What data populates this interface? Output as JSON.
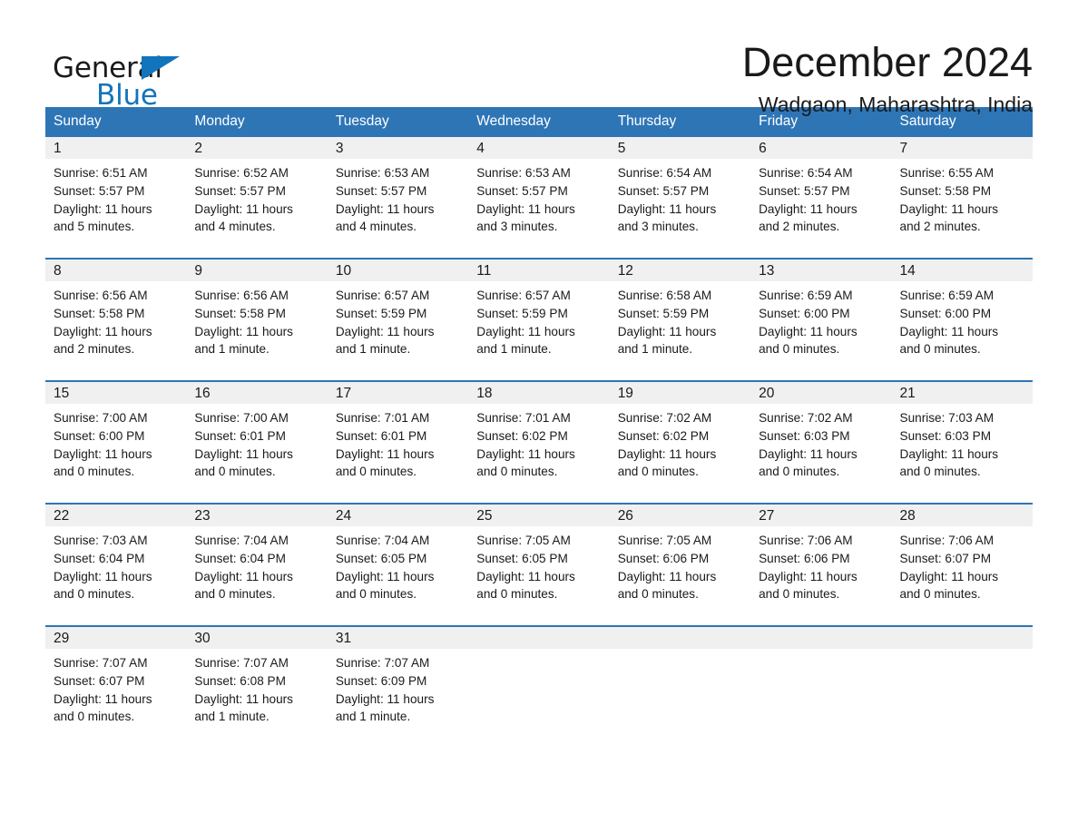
{
  "brand": {
    "word_general": "General",
    "word_blue": "Blue",
    "triangle_color": "#1274bc",
    "logo_icon": "general-blue-logo-icon"
  },
  "header": {
    "title": "December 2024",
    "location": "Wadgaon, Maharashtra, India"
  },
  "theme": {
    "header_bg": "#2e75b6",
    "header_text": "#ffffff",
    "daynum_band_bg": "#f0f0f0",
    "row_divider": "#2e75b6",
    "body_text": "#1a1a1a",
    "page_bg": "#ffffff"
  },
  "weekday_headers": [
    "Sunday",
    "Monday",
    "Tuesday",
    "Wednesday",
    "Thursday",
    "Friday",
    "Saturday"
  ],
  "labels": {
    "sunrise_prefix": "Sunrise:",
    "sunset_prefix": "Sunset:",
    "daylight_prefix": "Daylight:"
  },
  "weeks": [
    [
      {
        "day": "1",
        "sunrise": "Sunrise: 6:51 AM",
        "sunset": "Sunset: 5:57 PM",
        "daylight_line1": "Daylight: 11 hours",
        "daylight_line2": "and 5 minutes."
      },
      {
        "day": "2",
        "sunrise": "Sunrise: 6:52 AM",
        "sunset": "Sunset: 5:57 PM",
        "daylight_line1": "Daylight: 11 hours",
        "daylight_line2": "and 4 minutes."
      },
      {
        "day": "3",
        "sunrise": "Sunrise: 6:53 AM",
        "sunset": "Sunset: 5:57 PM",
        "daylight_line1": "Daylight: 11 hours",
        "daylight_line2": "and 4 minutes."
      },
      {
        "day": "4",
        "sunrise": "Sunrise: 6:53 AM",
        "sunset": "Sunset: 5:57 PM",
        "daylight_line1": "Daylight: 11 hours",
        "daylight_line2": "and 3 minutes."
      },
      {
        "day": "5",
        "sunrise": "Sunrise: 6:54 AM",
        "sunset": "Sunset: 5:57 PM",
        "daylight_line1": "Daylight: 11 hours",
        "daylight_line2": "and 3 minutes."
      },
      {
        "day": "6",
        "sunrise": "Sunrise: 6:54 AM",
        "sunset": "Sunset: 5:57 PM",
        "daylight_line1": "Daylight: 11 hours",
        "daylight_line2": "and 2 minutes."
      },
      {
        "day": "7",
        "sunrise": "Sunrise: 6:55 AM",
        "sunset": "Sunset: 5:58 PM",
        "daylight_line1": "Daylight: 11 hours",
        "daylight_line2": "and 2 minutes."
      }
    ],
    [
      {
        "day": "8",
        "sunrise": "Sunrise: 6:56 AM",
        "sunset": "Sunset: 5:58 PM",
        "daylight_line1": "Daylight: 11 hours",
        "daylight_line2": "and 2 minutes."
      },
      {
        "day": "9",
        "sunrise": "Sunrise: 6:56 AM",
        "sunset": "Sunset: 5:58 PM",
        "daylight_line1": "Daylight: 11 hours",
        "daylight_line2": "and 1 minute."
      },
      {
        "day": "10",
        "sunrise": "Sunrise: 6:57 AM",
        "sunset": "Sunset: 5:59 PM",
        "daylight_line1": "Daylight: 11 hours",
        "daylight_line2": "and 1 minute."
      },
      {
        "day": "11",
        "sunrise": "Sunrise: 6:57 AM",
        "sunset": "Sunset: 5:59 PM",
        "daylight_line1": "Daylight: 11 hours",
        "daylight_line2": "and 1 minute."
      },
      {
        "day": "12",
        "sunrise": "Sunrise: 6:58 AM",
        "sunset": "Sunset: 5:59 PM",
        "daylight_line1": "Daylight: 11 hours",
        "daylight_line2": "and 1 minute."
      },
      {
        "day": "13",
        "sunrise": "Sunrise: 6:59 AM",
        "sunset": "Sunset: 6:00 PM",
        "daylight_line1": "Daylight: 11 hours",
        "daylight_line2": "and 0 minutes."
      },
      {
        "day": "14",
        "sunrise": "Sunrise: 6:59 AM",
        "sunset": "Sunset: 6:00 PM",
        "daylight_line1": "Daylight: 11 hours",
        "daylight_line2": "and 0 minutes."
      }
    ],
    [
      {
        "day": "15",
        "sunrise": "Sunrise: 7:00 AM",
        "sunset": "Sunset: 6:00 PM",
        "daylight_line1": "Daylight: 11 hours",
        "daylight_line2": "and 0 minutes."
      },
      {
        "day": "16",
        "sunrise": "Sunrise: 7:00 AM",
        "sunset": "Sunset: 6:01 PM",
        "daylight_line1": "Daylight: 11 hours",
        "daylight_line2": "and 0 minutes."
      },
      {
        "day": "17",
        "sunrise": "Sunrise: 7:01 AM",
        "sunset": "Sunset: 6:01 PM",
        "daylight_line1": "Daylight: 11 hours",
        "daylight_line2": "and 0 minutes."
      },
      {
        "day": "18",
        "sunrise": "Sunrise: 7:01 AM",
        "sunset": "Sunset: 6:02 PM",
        "daylight_line1": "Daylight: 11 hours",
        "daylight_line2": "and 0 minutes."
      },
      {
        "day": "19",
        "sunrise": "Sunrise: 7:02 AM",
        "sunset": "Sunset: 6:02 PM",
        "daylight_line1": "Daylight: 11 hours",
        "daylight_line2": "and 0 minutes."
      },
      {
        "day": "20",
        "sunrise": "Sunrise: 7:02 AM",
        "sunset": "Sunset: 6:03 PM",
        "daylight_line1": "Daylight: 11 hours",
        "daylight_line2": "and 0 minutes."
      },
      {
        "day": "21",
        "sunrise": "Sunrise: 7:03 AM",
        "sunset": "Sunset: 6:03 PM",
        "daylight_line1": "Daylight: 11 hours",
        "daylight_line2": "and 0 minutes."
      }
    ],
    [
      {
        "day": "22",
        "sunrise": "Sunrise: 7:03 AM",
        "sunset": "Sunset: 6:04 PM",
        "daylight_line1": "Daylight: 11 hours",
        "daylight_line2": "and 0 minutes."
      },
      {
        "day": "23",
        "sunrise": "Sunrise: 7:04 AM",
        "sunset": "Sunset: 6:04 PM",
        "daylight_line1": "Daylight: 11 hours",
        "daylight_line2": "and 0 minutes."
      },
      {
        "day": "24",
        "sunrise": "Sunrise: 7:04 AM",
        "sunset": "Sunset: 6:05 PM",
        "daylight_line1": "Daylight: 11 hours",
        "daylight_line2": "and 0 minutes."
      },
      {
        "day": "25",
        "sunrise": "Sunrise: 7:05 AM",
        "sunset": "Sunset: 6:05 PM",
        "daylight_line1": "Daylight: 11 hours",
        "daylight_line2": "and 0 minutes."
      },
      {
        "day": "26",
        "sunrise": "Sunrise: 7:05 AM",
        "sunset": "Sunset: 6:06 PM",
        "daylight_line1": "Daylight: 11 hours",
        "daylight_line2": "and 0 minutes."
      },
      {
        "day": "27",
        "sunrise": "Sunrise: 7:06 AM",
        "sunset": "Sunset: 6:06 PM",
        "daylight_line1": "Daylight: 11 hours",
        "daylight_line2": "and 0 minutes."
      },
      {
        "day": "28",
        "sunrise": "Sunrise: 7:06 AM",
        "sunset": "Sunset: 6:07 PM",
        "daylight_line1": "Daylight: 11 hours",
        "daylight_line2": "and 0 minutes."
      }
    ],
    [
      {
        "day": "29",
        "sunrise": "Sunrise: 7:07 AM",
        "sunset": "Sunset: 6:07 PM",
        "daylight_line1": "Daylight: 11 hours",
        "daylight_line2": "and 0 minutes."
      },
      {
        "day": "30",
        "sunrise": "Sunrise: 7:07 AM",
        "sunset": "Sunset: 6:08 PM",
        "daylight_line1": "Daylight: 11 hours",
        "daylight_line2": "and 1 minute."
      },
      {
        "day": "31",
        "sunrise": "Sunrise: 7:07 AM",
        "sunset": "Sunset: 6:09 PM",
        "daylight_line1": "Daylight: 11 hours",
        "daylight_line2": "and 1 minute."
      },
      {
        "day": "",
        "sunrise": "",
        "sunset": "",
        "daylight_line1": "",
        "daylight_line2": ""
      },
      {
        "day": "",
        "sunrise": "",
        "sunset": "",
        "daylight_line1": "",
        "daylight_line2": ""
      },
      {
        "day": "",
        "sunrise": "",
        "sunset": "",
        "daylight_line1": "",
        "daylight_line2": ""
      },
      {
        "day": "",
        "sunrise": "",
        "sunset": "",
        "daylight_line1": "",
        "daylight_line2": ""
      }
    ]
  ]
}
